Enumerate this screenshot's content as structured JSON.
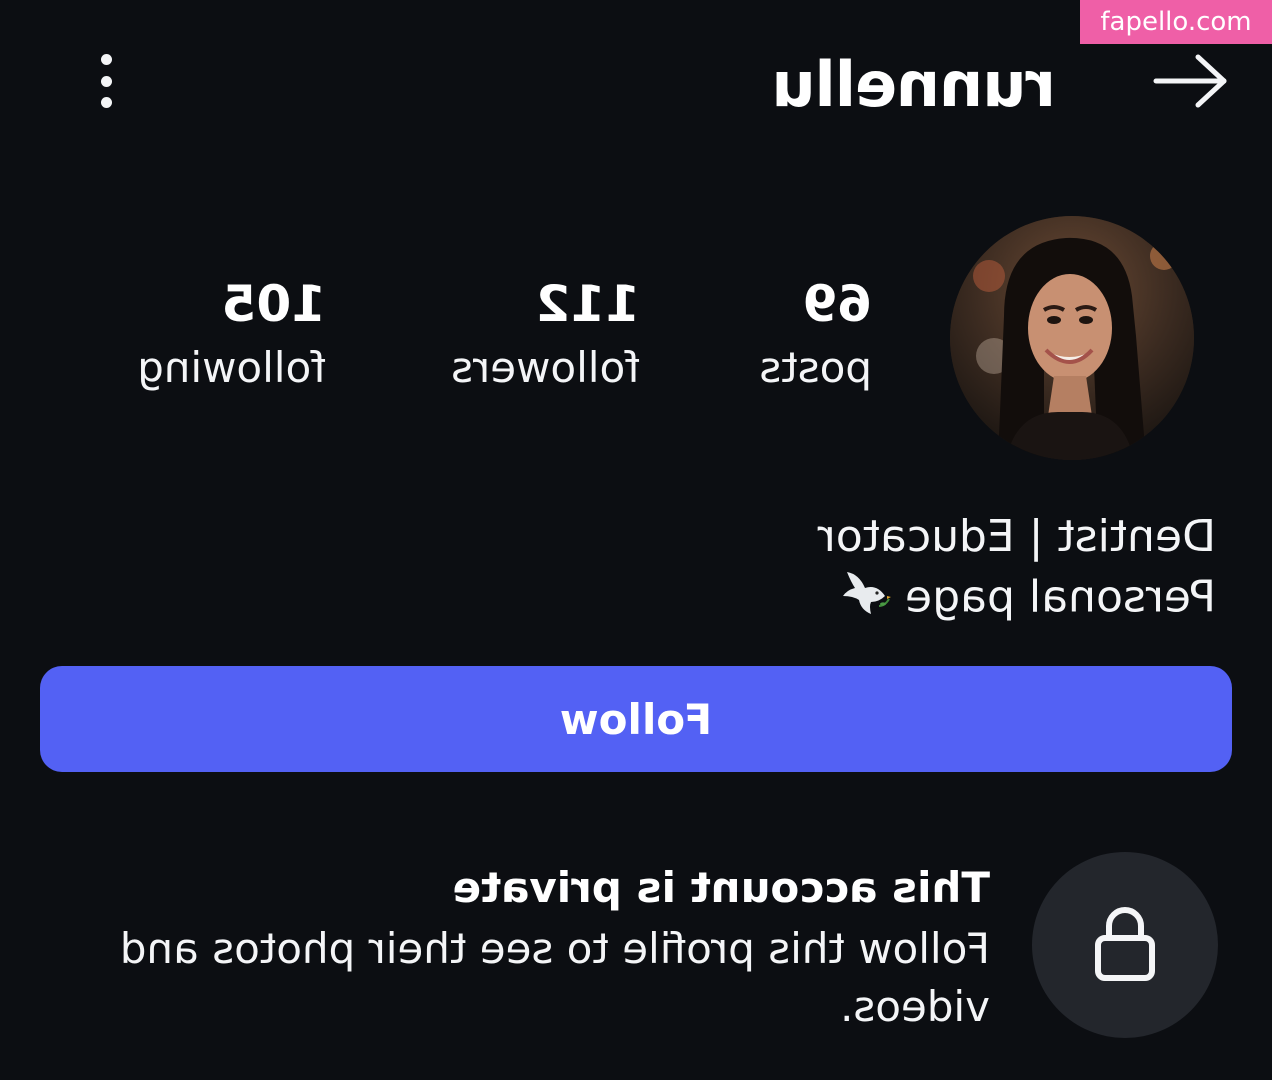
{
  "watermark": {
    "text": "fapello.com",
    "color": "#ef5fa7"
  },
  "header": {
    "back_icon": "arrow-left-icon",
    "username": "runnellu",
    "menu_icon": "more-vertical-icon"
  },
  "profile": {
    "avatar_alt": "profile-photo",
    "stats": [
      {
        "value": "69",
        "label": "posts"
      },
      {
        "value": "112",
        "label": "followers"
      },
      {
        "value": "105",
        "label": "following"
      }
    ],
    "bio": {
      "line1": "Dentist | Educator",
      "line2": "Personal page",
      "line2_emoji": "dove-icon"
    }
  },
  "actions": {
    "follow_label": "Follow",
    "accent": "#5361f4"
  },
  "private_notice": {
    "icon": "lock-icon",
    "title": "This account is private",
    "description": "Follow this profile to see their photos and videos."
  }
}
